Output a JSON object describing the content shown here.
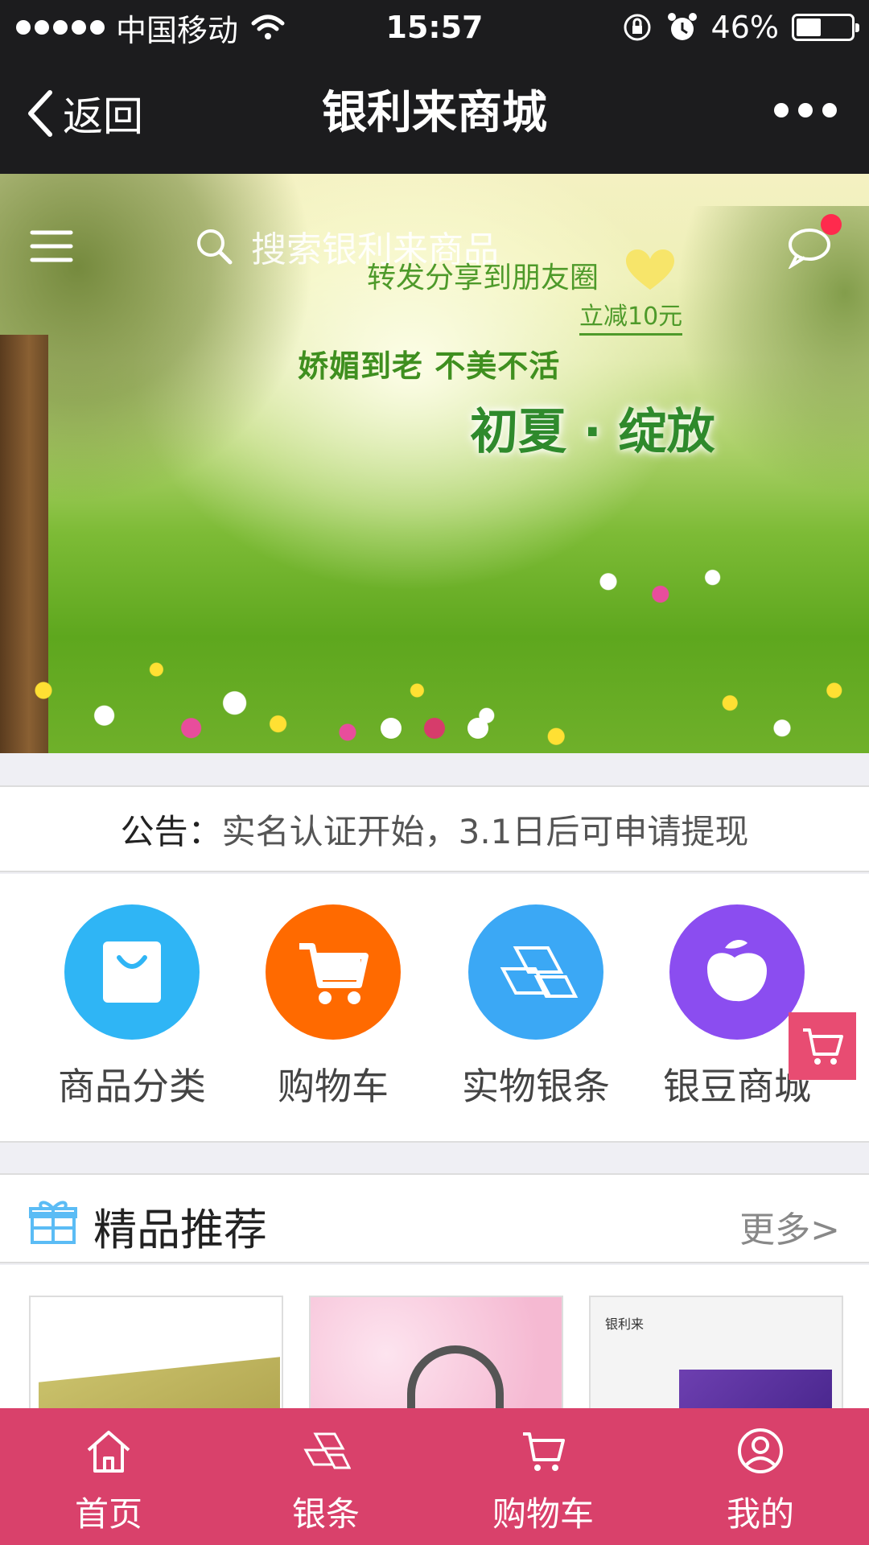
{
  "status_bar": {
    "carrier": "中国移动",
    "time": "15:57",
    "battery_text": "46%",
    "battery_level": 0.46
  },
  "nav": {
    "back_label": "返回",
    "title": "银利来商城"
  },
  "banner": {
    "search_placeholder": "搜索银利来商品",
    "promo_share": "转发分享到朋友圈",
    "promo_discount": "立减10元",
    "promo_slogan": "娇媚到老  不美不活",
    "promo_headline": "初夏 · 绽放",
    "active_slide": 2,
    "slide_count": 3
  },
  "notice": {
    "label": "公告：",
    "text": "实名认证开始，3.1日后可申请提现"
  },
  "quick_menu": [
    {
      "label": "商品分类",
      "icon": "shopping-bag-icon",
      "color": "#2fb5f5"
    },
    {
      "label": "购物车",
      "icon": "cart-icon",
      "color": "#ff6a00"
    },
    {
      "label": "实物银条",
      "icon": "silver-bar-icon",
      "color": "#3ba8f5"
    },
    {
      "label": "银豆商城",
      "icon": "bean-icon",
      "color": "#8b4df0"
    }
  ],
  "featured": {
    "title": "精品推荐",
    "more": "更多>",
    "product3_logo": "银利来"
  },
  "tab_bar": [
    {
      "label": "首页",
      "icon": "home-icon"
    },
    {
      "label": "银条",
      "icon": "silver-bar-icon"
    },
    {
      "label": "购物车",
      "icon": "cart-icon"
    },
    {
      "label": "我的",
      "icon": "user-icon"
    }
  ],
  "colors": {
    "nav_bg": "#1c1c1e",
    "tab_bar_bg": "#d9416b",
    "accent": "#e84c72"
  }
}
